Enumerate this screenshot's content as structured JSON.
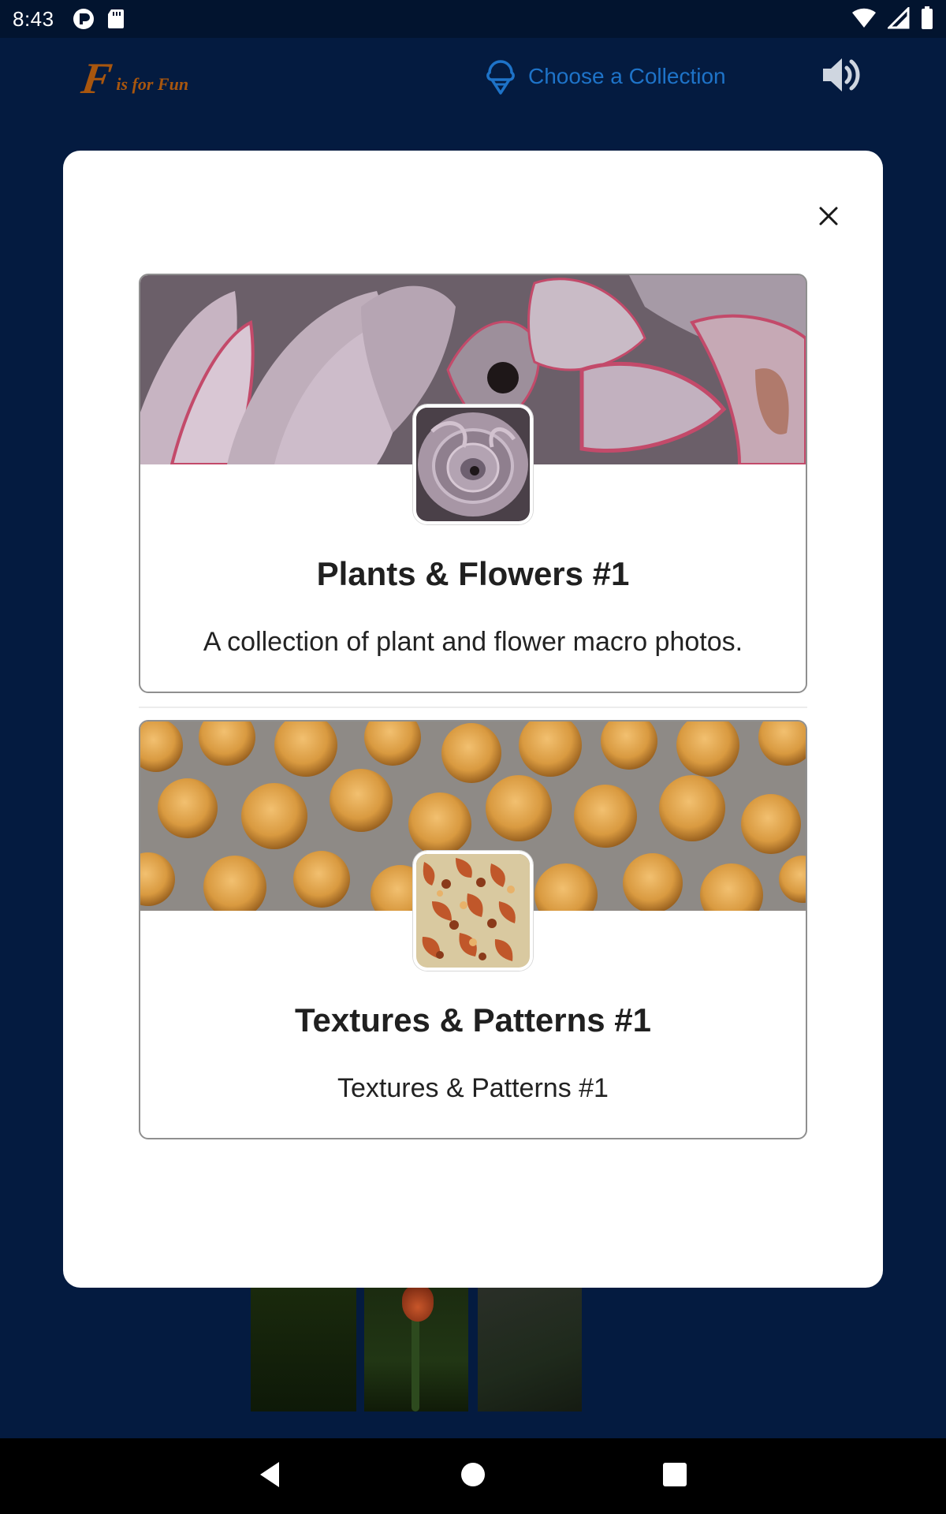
{
  "status_bar": {
    "time": "8:43"
  },
  "header": {
    "logo_letter": "F",
    "logo_text": "is for Fun",
    "choose_collection_label": "Choose a Collection"
  },
  "modal": {
    "close_label": "×",
    "collections": [
      {
        "title": "Plants & Flowers #1",
        "description": "A collection of plant and flower macro photos."
      },
      {
        "title": "Textures & Patterns #1",
        "description": "Textures & Patterns #1"
      }
    ]
  },
  "colors": {
    "background": "#041b40",
    "status_bar": "#02142f",
    "accent_blue": "#1e73c8",
    "logo_orange": "#a8560e",
    "modal_bg": "#ffffff",
    "nav_bar": "#000000"
  },
  "icons": {
    "status": [
      "app-notification-icon",
      "sd-card-icon",
      "wifi-icon",
      "cell-signal-icon",
      "battery-icon"
    ],
    "header": [
      "ice-cream-icon",
      "speaker-icon"
    ],
    "navigation": [
      "back-icon",
      "home-icon",
      "recents-icon"
    ]
  }
}
